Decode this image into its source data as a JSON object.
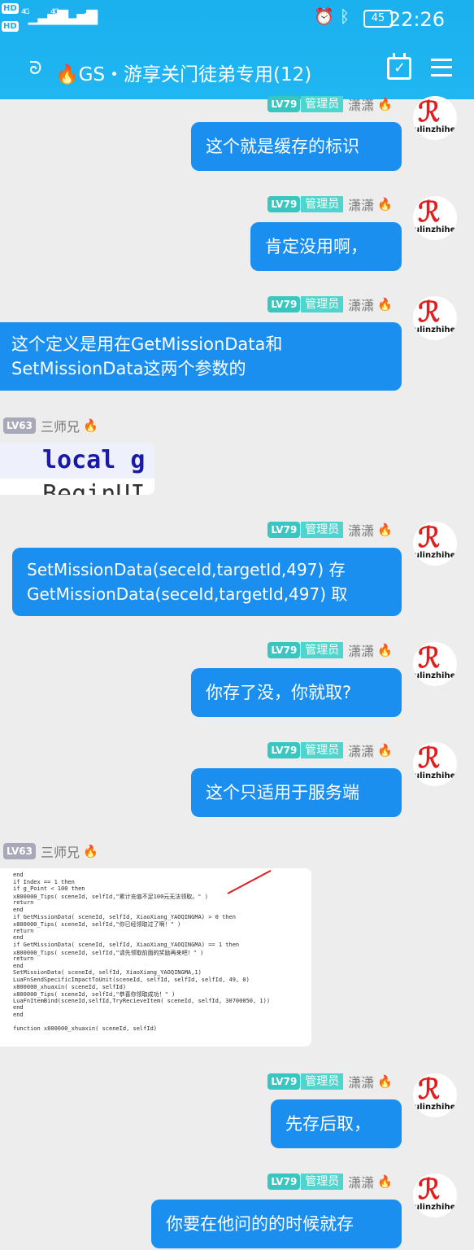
{
  "status": {
    "hd1": "HD",
    "hd2": "HD",
    "signal1": "4G",
    "signal2": "4G",
    "battery": "45",
    "time": "22:26"
  },
  "header": {
    "title": "🔥GS・游享关门徒弟专用(12)"
  },
  "colors": {
    "bubble": "#1a8fef",
    "header": "#1bb0ee",
    "badge_admin": "#39c6c1",
    "badge_member": "#a8a8b8"
  },
  "admin": {
    "level": "LV79",
    "role": "管理员",
    "nick": "潇潇",
    "avatar_text": "ulinzhihe"
  },
  "member": {
    "level": "LV63",
    "nick": "三师兄"
  },
  "messages": [
    {
      "text": "这个就是缓存的标识"
    },
    {
      "text": "肯定没用啊，"
    },
    {
      "line1": "这个定义是用在GetMissionData和",
      "line2": "SetMissionData这两个参数的"
    },
    {
      "image_text": "local g",
      "image_text2": "BeginUI"
    },
    {
      "line1": "SetMissionData(seceId,targetId,497) 存",
      "line2": "GetMissionData(seceId,targetId,497) 取"
    },
    {
      "text": "你存了没，你就取?"
    },
    {
      "text": "这个只适用于服务端"
    },
    {
      "code": [
        "end",
        "if Index == 1 then",
        "    if g_Point < 100 then",
        "    x800000_Tips( sceneId, selfId,\"累计充值不足100元无法领取。\" )",
        "    return",
        "    end",
        "    if  GetMissionData( sceneId, selfId, XiaoXiang_YAOQINGMA) > 0 then",
        "    x800000_Tips( sceneId, selfId,\"你已经领取过了啊！\" )",
        "    return",
        "    end",
        "    if  GetMissionData( sceneId, selfId, XiaoXiang_YAOQINGMA) == 1 then",
        "    x800000_Tips( sceneId, selfId,\"请先领取前面的奖励再来吧！\" )",
        "    return",
        "    end",
        "    SetMissionData( sceneId, selfId, XiaoXiang_YAOQINGMA,1)",
        "    LuaFnSendSpecificImpactToUnit(sceneId, selfId, selfId, selfId, 49, 0)",
        "    x800000_xhuaxin( sceneId, selfId)",
        "    x800000_Tips( sceneId, selfId,\"恭喜你领取成功！\" )",
        "    LuaFnItemBind(sceneId,selfId,TryRecieveItem( sceneId, selfId, 30700050, 1))",
        "end",
        "end",
        "",
        "function x800000_xhuaxin( sceneId, selfId)"
      ]
    },
    {
      "text": "先存后取，"
    },
    {
      "text": "你要在他问的的时候就存"
    }
  ]
}
